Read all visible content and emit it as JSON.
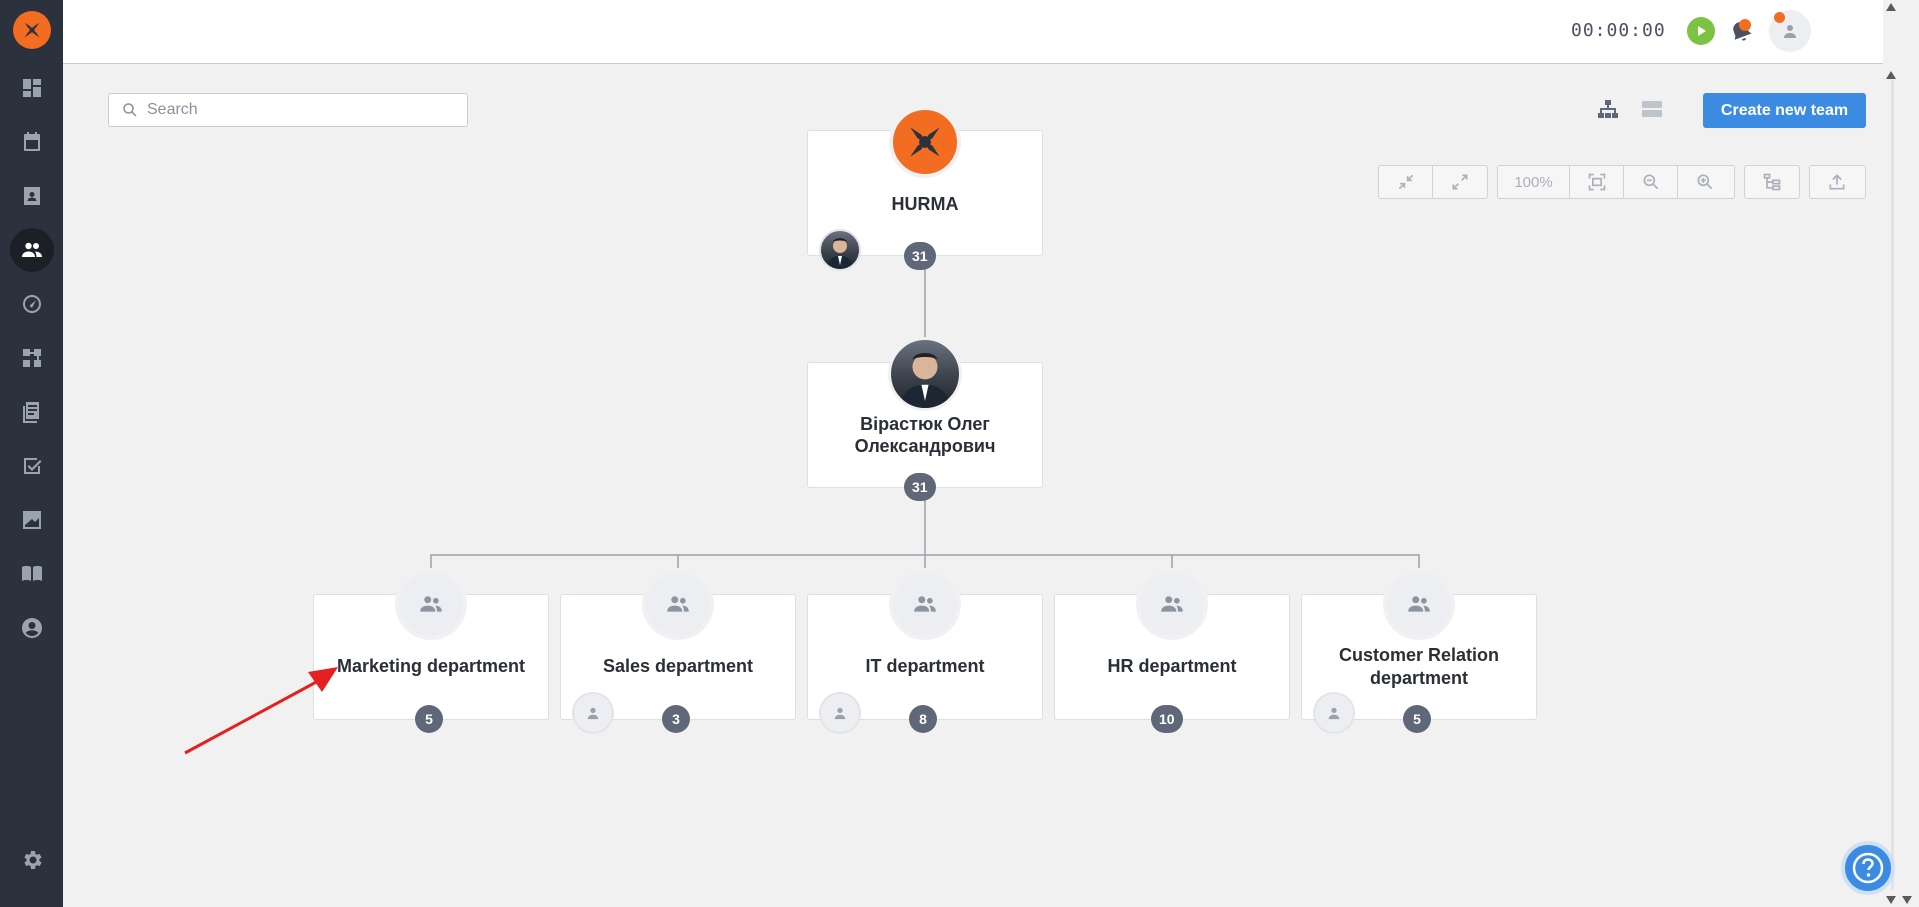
{
  "topbar": {
    "timer": "00:00:00"
  },
  "search": {
    "placeholder": "Search"
  },
  "actions": {
    "create_team": "Create new team"
  },
  "toolbar": {
    "zoom_level": "100%"
  },
  "org": {
    "root": {
      "name": "HURMA",
      "count": "31"
    },
    "head": {
      "name_line1": "Вірастюк Олег",
      "name_line2": "Олександрович",
      "count": "31"
    },
    "departments": [
      {
        "name": "Marketing department",
        "count": "5"
      },
      {
        "name": "Sales department",
        "count": "3"
      },
      {
        "name": "IT department",
        "count": "8"
      },
      {
        "name": "HR department",
        "count": "10"
      },
      {
        "name_line1": "Customer Relation",
        "name_line2": "department",
        "count": "5"
      }
    ]
  },
  "colors": {
    "brand": "#f26d21",
    "accent": "#3b8be3",
    "sidebar": "#2c323d",
    "badge": "#5f6878",
    "annotation_arrow": "#e52020"
  }
}
